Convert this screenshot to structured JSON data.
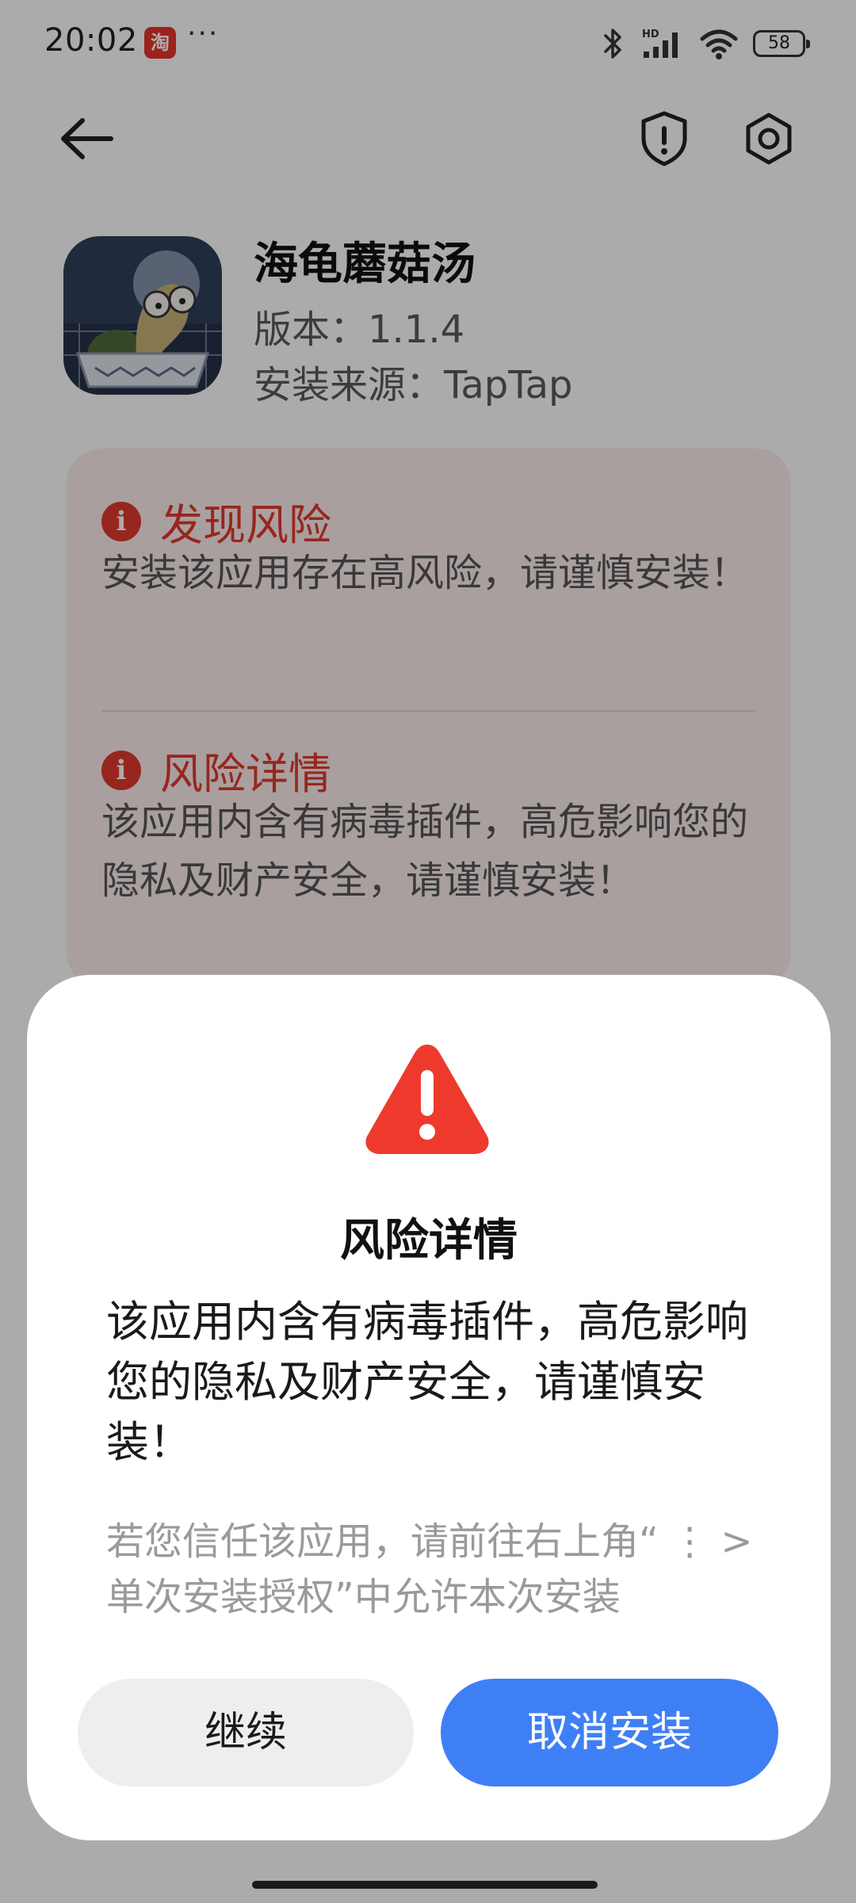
{
  "status_bar": {
    "time": "20:02",
    "app_icon_glyph": "淘",
    "more_dots": "···",
    "icons": [
      "bluetooth-icon",
      "hd-signal-icon",
      "wifi-icon"
    ],
    "battery": "58"
  },
  "header": {
    "back_icon": "arrow-left-icon",
    "shield_icon": "shield-alert-icon",
    "settings_icon": "gear-icon"
  },
  "app": {
    "name": "海龟蘑菇汤",
    "version": "版本：1.1.4",
    "source": "安装来源：TapTap"
  },
  "risk_card": {
    "found_title": "发现风险",
    "found_body": "安装该应用存在高风险，请谨慎安装！",
    "detail_title": "风险详情",
    "detail_body": "该应用内含有病毒插件，高危影响您的隐私及财产安全，请谨慎安装！"
  },
  "dialog": {
    "icon": "warning-triangle-icon",
    "title": "风险详情",
    "body": "该应用内含有病毒插件，高危影响您的隐私及财产安全，请谨慎安装！",
    "hint": "若您信任该应用，请前往右上角“ ⋮ > 单次安装授权”中允许本次安装",
    "continue_label": "继续",
    "cancel_label": "取消安装"
  },
  "colors": {
    "danger": "#e23a2e",
    "primary": "#3f7ff5"
  }
}
